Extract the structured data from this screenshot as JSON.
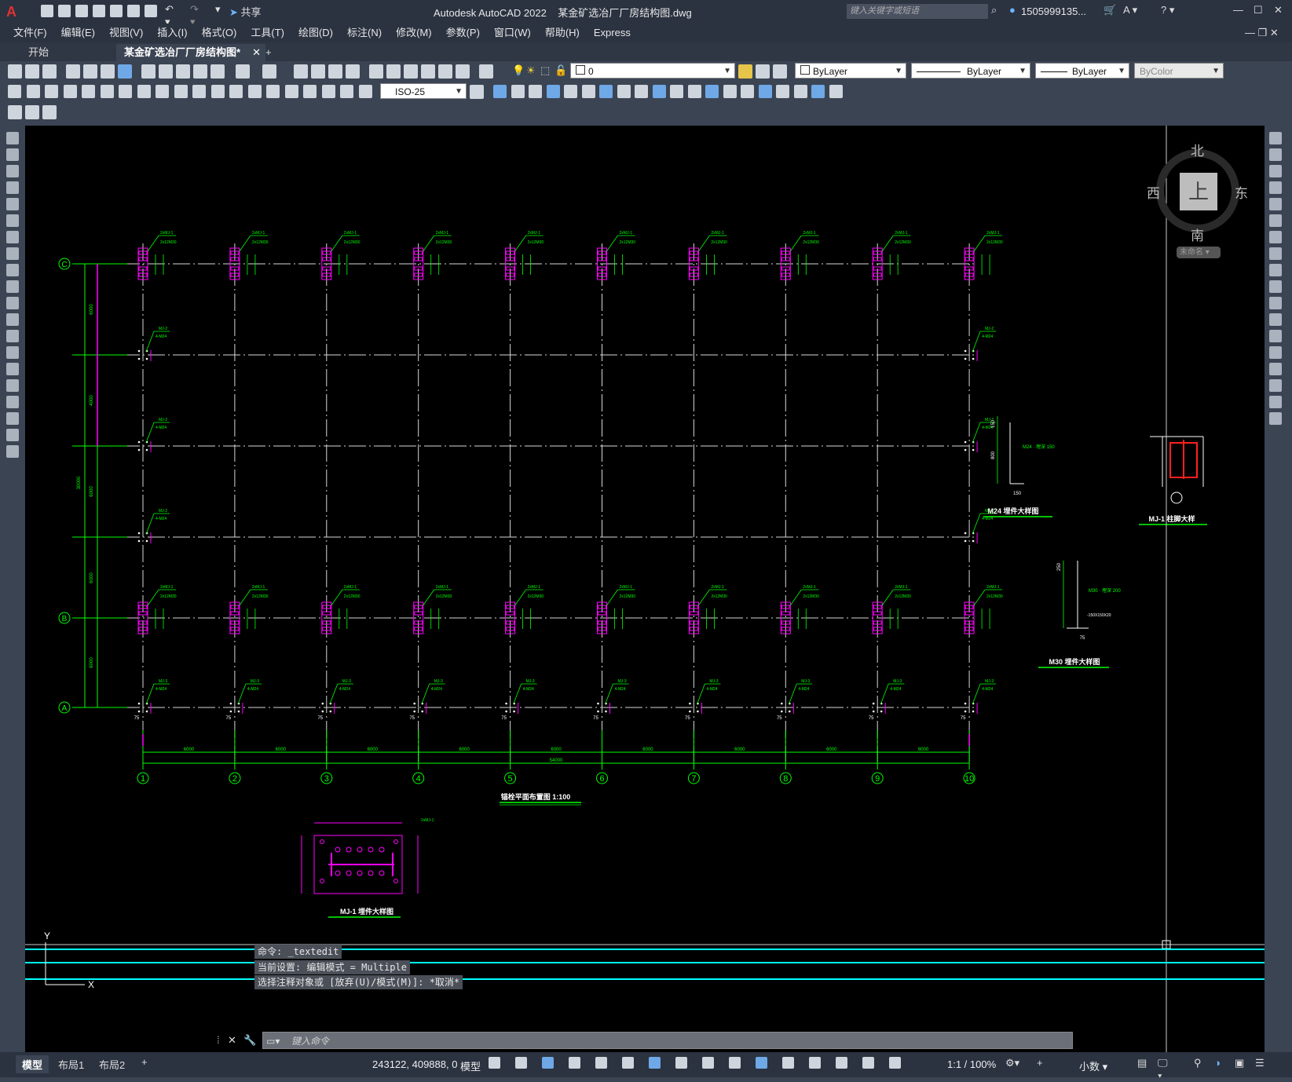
{
  "window": {
    "title": "Autodesk AutoCAD 2022    某金矿选冶厂厂房结构图.dwg",
    "share_label": "共享",
    "search_placeholder": "键入关键字或短语",
    "user": "1505999135...",
    "controls": [
      "—",
      "☐",
      "✕"
    ]
  },
  "menu": [
    "文件(F)",
    "编辑(E)",
    "视图(V)",
    "插入(I)",
    "格式(O)",
    "工具(T)",
    "绘图(D)",
    "标注(N)",
    "修改(M)",
    "参数(P)",
    "窗口(W)",
    "帮助(H)",
    "Express"
  ],
  "tabs": {
    "start": "开始",
    "active": "某金矿选冶厂厂房结构图*",
    "close": "✕",
    "add": "+"
  },
  "toolbar": {
    "layer": "0",
    "color": "ByLayer",
    "linetype": "ByLayer",
    "lineweight": "ByLayer",
    "plotstyle": "ByColor",
    "dimstyle": "ISO-25"
  },
  "viewcube": {
    "north": "北",
    "south": "南",
    "east": "东",
    "west": "西",
    "top": "上",
    "ucs": "未命名"
  },
  "drawing": {
    "plan_title": "锚栓平面布置图",
    "plan_scale": "1:100",
    "axes_x": [
      "1",
      "2",
      "3",
      "4",
      "5",
      "6",
      "7",
      "8",
      "9",
      "10"
    ],
    "axes_y": [
      "C",
      "B",
      "A"
    ],
    "span_labels": [
      "6000",
      "6000",
      "6000",
      "6000",
      "6000",
      "6000",
      "6000",
      "6000",
      "6000"
    ],
    "total_width": "54000",
    "left_dims": [
      "6000",
      "4000",
      "6000",
      "6000",
      "6000"
    ],
    "total_height": "30000",
    "tag_mj1": "2xMJ-1",
    "tag_mj1_bolts": "2x12M30",
    "tag_mj2": "MJ-2",
    "tag_mj2_bolts": "4-M24",
    "tag_mj3": "MJ-3",
    "tag_mj3_bolts": "4-M24",
    "dim_75": "75",
    "detail_mj1": "MJ-1  埋件大样图",
    "detail_m24": "M24  埋件大样图",
    "detail_m30": "M30  埋件大样图",
    "detail_column": "MJ-1  柱脚大样",
    "m24_note": "M24 · 埋深 150",
    "m30_note": "M30 · 埋深 200",
    "m30_plate": "-150X150X20",
    "dim_150": "150",
    "dim_800": "800",
    "dim_250": "250"
  },
  "command": {
    "line1": "命令:  _textedit",
    "line2": "当前设置: 编辑模式 = Multiple",
    "line3": "选择注释对象或 [放弃(U)/模式(M)]: *取消*",
    "input_placeholder": "键入命令"
  },
  "layout_tabs": [
    "模型",
    "布局1",
    "布局2"
  ],
  "status": {
    "coords": "243122, 409888, 0",
    "model": "模型",
    "scale": "1:1 / 100%",
    "units": "小数"
  }
}
